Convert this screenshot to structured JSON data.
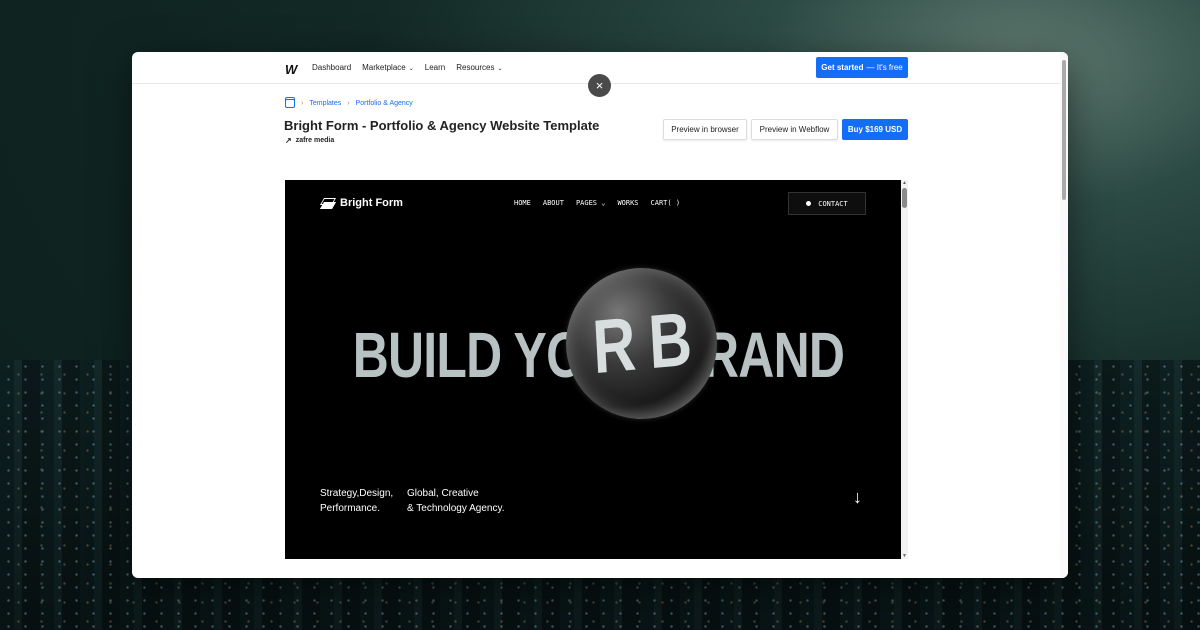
{
  "topnav": {
    "logo": "W",
    "links": [
      "Dashboard",
      "Marketplace",
      "Learn",
      "Resources"
    ],
    "cta_bold": "Get started",
    "cta_light": "— It's free"
  },
  "breadcrumb": [
    "Templates",
    "Portfolio & Agency"
  ],
  "template": {
    "title": "Bright Form - Portfolio & Agency Website Template",
    "author": "zafre media",
    "preview_browser": "Preview in browser",
    "preview_webflow": "Preview in Webflow",
    "buy": "Buy  $169 USD"
  },
  "close_label": "×",
  "preview_site": {
    "brand": "Bright Form",
    "nav": [
      "HOME",
      "ABOUT",
      "PAGES",
      "WORKS",
      "CART( )"
    ],
    "contact": "CONTACT",
    "hero": "BUILD YOUR BRAND",
    "sphere_text": "R B",
    "tag1": [
      "Strategy,Design,",
      "Performance."
    ],
    "tag2": [
      "Global, Creative",
      "& Technology Agency."
    ],
    "arrow": "↓"
  },
  "colors": {
    "accent": "#146ef5",
    "preview_bg": "#000000",
    "hero_text": "#b9c2c2"
  }
}
